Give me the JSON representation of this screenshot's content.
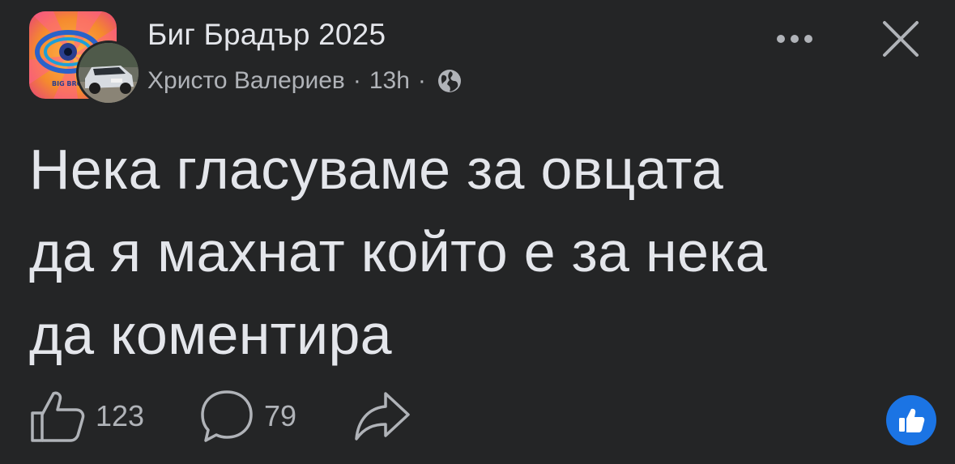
{
  "post": {
    "group_name": "Биг Брадър 2025",
    "author": "Христо Валериев",
    "separator": "·",
    "time": "13h",
    "group_avatar_text": "BIG BRO",
    "text_lines": [
      "Нека гласуваме за овцата",
      "да я махнат който е за нека",
      "да коментира"
    ],
    "like_count": "123",
    "comment_count": "79"
  },
  "icons": {
    "more": "more-horizontal-icon",
    "close": "close-icon",
    "privacy": "globe-icon",
    "like": "thumbs-up-icon",
    "comment": "comment-bubble-icon",
    "share": "share-arrow-icon",
    "reaction": "like-reaction-icon"
  },
  "colors": {
    "background": "#242526",
    "primary_text": "#e4e6eb",
    "secondary_text": "#b0b3b8",
    "reaction_blue": "#1b74e4",
    "group_avatar_orange": "#f58a2e",
    "group_avatar_pink": "#e8437a"
  }
}
